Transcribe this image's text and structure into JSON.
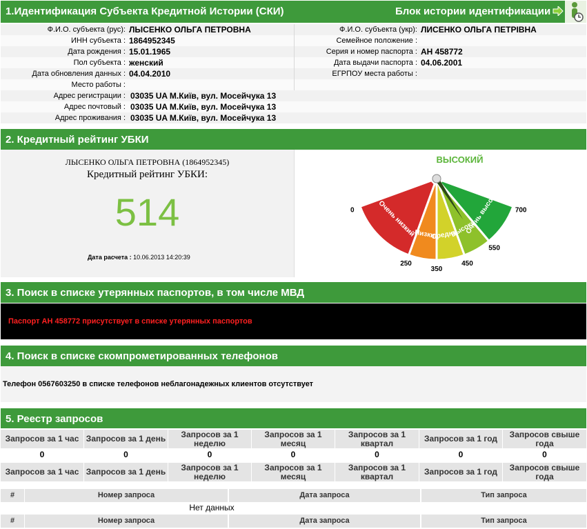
{
  "section1": {
    "title": "1.Идентификация Субъекта Кредитной Истории (СКИ)",
    "history_block": "Блок истории идентификации",
    "left_rows": [
      {
        "label": "Ф.И.О. субъекта (рус):",
        "value": "ЛЫСЕНКО ОЛЬГА ПЕТРОВНА"
      },
      {
        "label": "ИНН субъекта :",
        "value": "1864952345"
      },
      {
        "label": "Дата рождения :",
        "value": "15.01.1965"
      },
      {
        "label": "Пол субъекта :",
        "value": "женский"
      },
      {
        "label": "Дата обновления данных :",
        "value": "04.04.2010"
      },
      {
        "label": "Место работы :",
        "value": ""
      }
    ],
    "right_rows": [
      {
        "label": "Ф.И.О. субъекта (укр):",
        "value": "ЛИСЕНКО ОЛЬГА ПЕТРІВНА"
      },
      {
        "label": "Семейное положение :",
        "value": ""
      },
      {
        "label": "Серия и номер паспорта :",
        "value": "АН 458772"
      },
      {
        "label": "Дата выдачи паспорта :",
        "value": "04.06.2001"
      },
      {
        "label": "ЕГРПОУ места работы :",
        "value": ""
      }
    ],
    "address_rows": [
      {
        "label": "Адрес регистрации :",
        "value": "03035 UA М.Київ, вул. Мосейчука 13"
      },
      {
        "label": "Адрес почтовый :",
        "value": "03035 UA М.Київ, вул. Мосейчука 13"
      },
      {
        "label": "Адрес проживания :",
        "value": "03035 UA М.Київ, вул. Мосейчука 13"
      }
    ]
  },
  "section2": {
    "title": "2. Кредитный рейтинг УБКИ",
    "subject": "ЛЫСЕНКО ОЛЬГА ПЕТРОВНА (1864952345)",
    "rating_title": "Кредитный рейтинг УБКИ:",
    "score": "514",
    "calc_label": "Дата расчета :",
    "calc_value": "10.06.2013 14:20:39",
    "gauge": {
      "level": "ВЫСОКИЙ",
      "ticks": [
        "0",
        "250",
        "350",
        "450",
        "550",
        "700"
      ],
      "segments": [
        "Очень низкий",
        "Низкий",
        "Средний",
        "Высокий",
        "Очень высокий"
      ],
      "colors": [
        "#d42a2a",
        "#f08a1e",
        "#d2d22a",
        "#8ec12b",
        "#22a63a"
      ],
      "score_value": 514
    }
  },
  "section3": {
    "title": "3. Поиск в списке утерянных паспортов, в том числе МВД",
    "message": "Паспорт АН 458772 присутствует в списке утерянных паспортов"
  },
  "section4": {
    "title": "4. Поиск в списке скомпрометированных телефонов",
    "message": "Телефон 0567603250 в списке телефонов неблагонадежных клиентов отсутствует"
  },
  "section5": {
    "title": "5. Реестр запросов",
    "headers": [
      "Запросов за 1 час",
      "Запросов за 1 день",
      "Запросов за 1 неделю",
      "Запросов за 1 месяц",
      "Запросов за 1 квартал",
      "Запросов за 1 год",
      "Запросов свыше года"
    ],
    "values": [
      "0",
      "0",
      "0",
      "0",
      "0",
      "0",
      "0"
    ],
    "list_headers": [
      "#",
      "Номер запроса",
      "Дата запроса",
      "Тип запроса"
    ],
    "no_data": "Нет данных"
  }
}
